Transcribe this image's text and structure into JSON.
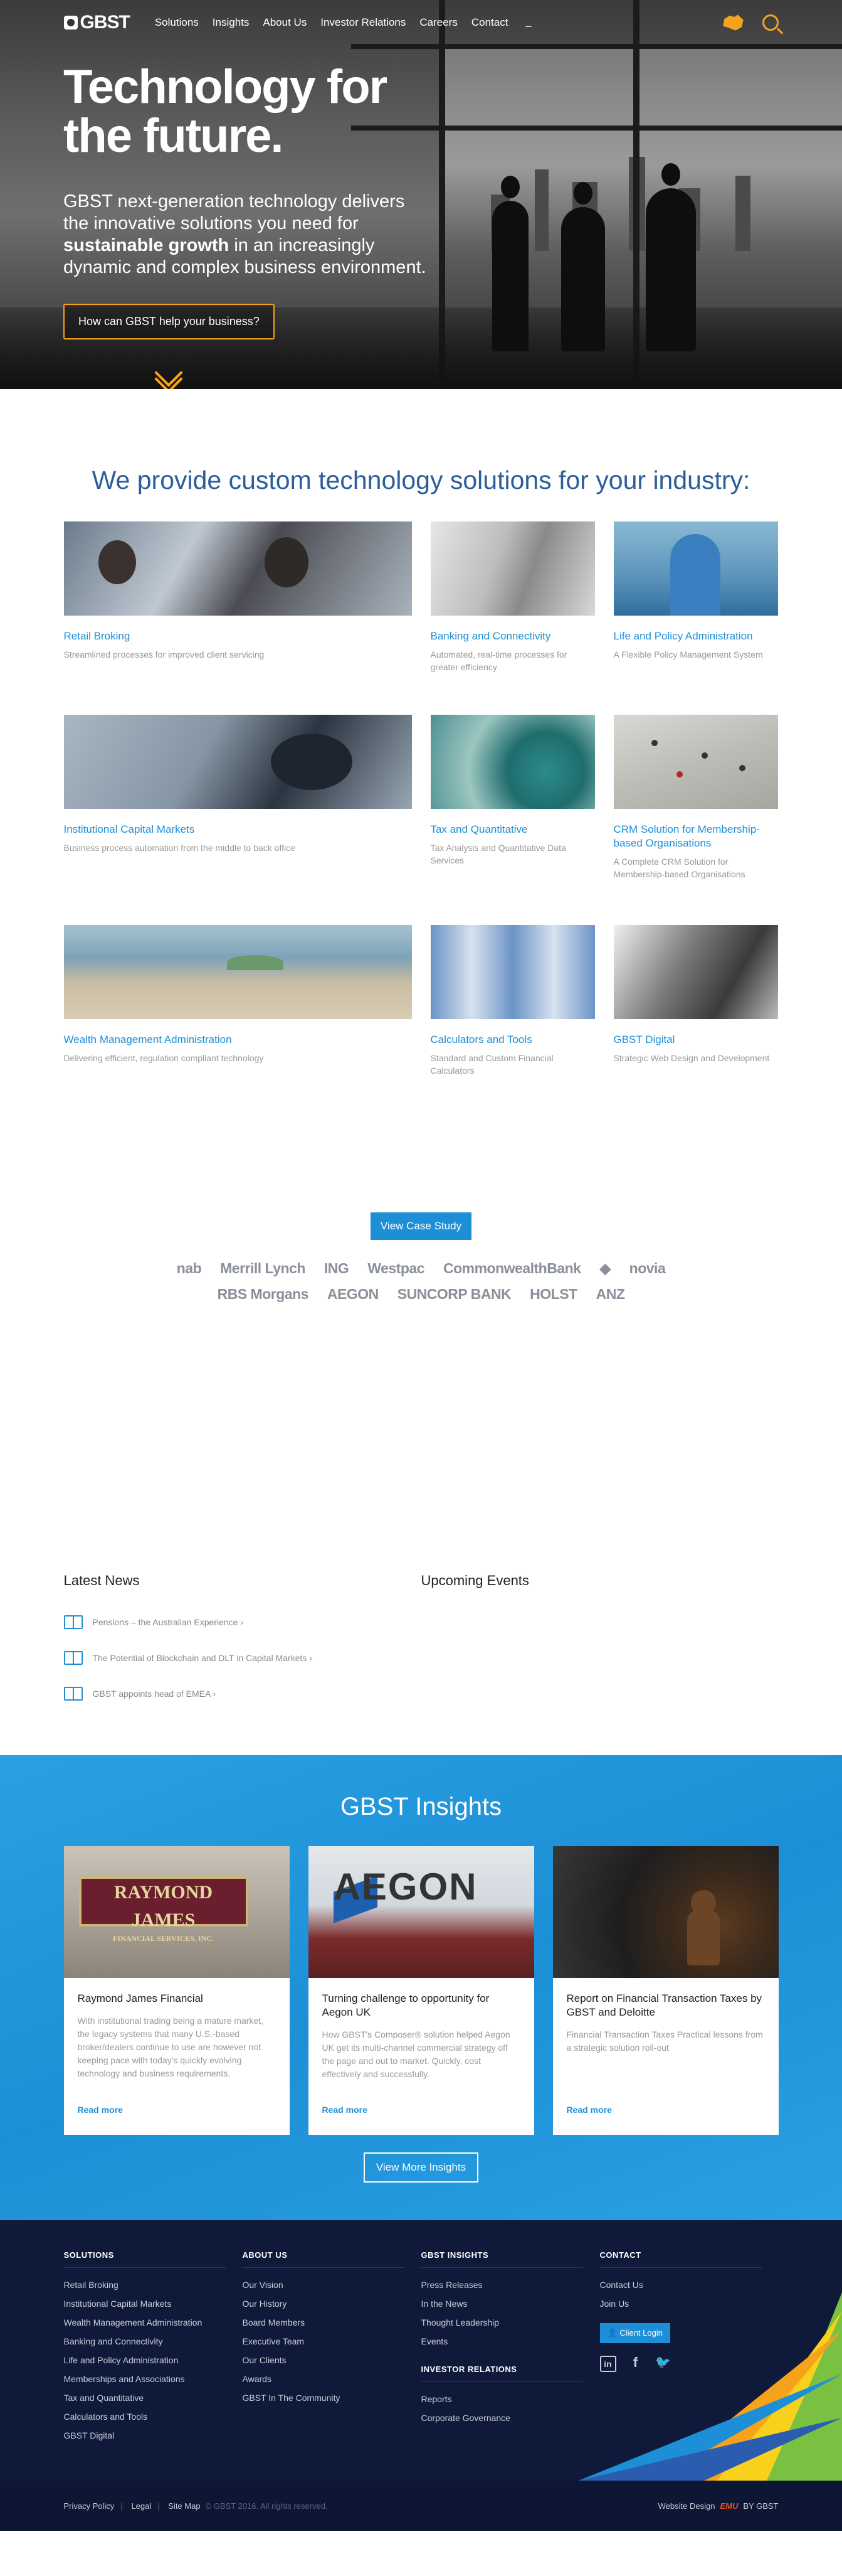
{
  "header": {
    "logo": "GBST",
    "nav": [
      "Solutions",
      "Insights",
      "About Us",
      "Investor Relations",
      "Careers",
      "Contact"
    ],
    "nav_extra": "_",
    "icons": [
      "australia-map-icon",
      "search-icon"
    ]
  },
  "hero": {
    "title": "Technology for the future.",
    "body_1": "GBST next-generation technology delivers the innovative solutions you need for ",
    "body_strong": "sustainable growth",
    "body_2": " in an increasingly dynamic and complex business environment.",
    "cta": "How can GBST help your business?"
  },
  "industries": {
    "title": "We provide custom technology solutions for your industry:",
    "cards": [
      {
        "title": "Retail Broking",
        "desc": "Streamlined processes for improved client servicing"
      },
      {
        "title": "Banking and Connectivity",
        "desc": "Automated, real-time processes for greater efficiency"
      },
      {
        "title": "Life and Policy Administration",
        "desc": "A Flexible Policy Management System"
      },
      {
        "title": "Institutional Capital Markets",
        "desc": "Business process automation from the middle to back office"
      },
      {
        "title": "Tax and Quantitative",
        "desc": "Tax Analysis and Quantitative Data Services"
      },
      {
        "title": "CRM Solution for Membership-based Organisations",
        "desc": "A Complete CRM Solution for Membership-based Organisations"
      },
      {
        "title": "Wealth Management Administration",
        "desc": "Delivering efficient, regulation compliant technology"
      },
      {
        "title": "Calculators and Tools",
        "desc": "Standard and Custom Financial Calculators"
      },
      {
        "title": "GBST Digital",
        "desc": "Strategic Web Design and Development"
      }
    ],
    "case_study_button": "View Case Study",
    "client_logos": [
      "nab",
      "Merrill Lynch",
      "ING",
      "Westpac",
      "CommonwealthBank",
      "◆",
      "novia",
      "RBS Morgans",
      "AEGON",
      "SUNCORP BANK",
      "HOLST",
      "ANZ"
    ]
  },
  "news": {
    "latest_title": "Latest News",
    "upcoming_title": "Upcoming Events",
    "items": [
      "Pensions – the Australian Experience ›",
      "The Potential of Blockchain and DLT in Capital Markets ›",
      "GBST appoints head of EMEA ›"
    ]
  },
  "insights": {
    "title": "GBST Insights",
    "cards": [
      {
        "title": "Raymond James Financial",
        "desc": "With institutional trading being a mature market, the legacy systems that many U.S.-based broker/dealers continue to use are however not keeping pace with today's quickly evolving technology and business requirements.",
        "more": "Read more",
        "sign": "RAYMOND JAMES",
        "sign_sub": "FINANCIAL SERVICES, INC."
      },
      {
        "title": "Turning challenge to opportunity for Aegon UK",
        "desc": "How GBST's Composer® solution helped Aegon UK get its multi-channel commercial strategy off the page and out to market. Quickly, cost effectively and successfully.",
        "more": "Read more",
        "sign": "AEGON"
      },
      {
        "title": "Report on Financial Transaction Taxes by GBST and Deloitte",
        "desc": "Financial Transaction Taxes Practical lessons from a strategic solution roll-out",
        "more": "Read more"
      }
    ],
    "more_button": "View More Insights"
  },
  "footer": {
    "solutions": {
      "title": "SOLUTIONS",
      "items": [
        "Retail Broking",
        "Institutional Capital Markets",
        "Wealth Management Administration",
        "Banking and Connectivity",
        "Life and Policy Administration",
        "Memberships and Associations",
        "Tax and Quantitative",
        "Calculators and Tools",
        "GBST Digital"
      ]
    },
    "about": {
      "title": "ABOUT US",
      "items": [
        "Our Vision",
        "Our History",
        "Board Members",
        "Executive Team",
        "Our Clients",
        "Awards",
        "GBST In The Community"
      ]
    },
    "insights": {
      "title": "GBST INSIGHTS",
      "items": [
        "Press Releases",
        "In the News",
        "Thought Leadership",
        "Events"
      ]
    },
    "investor": {
      "title": "INVESTOR RELATIONS",
      "items": [
        "Reports",
        "Corporate Governance"
      ]
    },
    "contact": {
      "title": "CONTACT",
      "items": [
        "Contact Us",
        "Join Us"
      ],
      "login": "Client Login"
    },
    "social": [
      "linkedin-icon",
      "facebook-icon",
      "twitter-icon"
    ],
    "bottom": {
      "links": [
        "Privacy Policy",
        "Legal",
        "Site Map"
      ],
      "copyright": "© GBST 2016. All rights reserved.",
      "credit": "Website Design",
      "credit_brand": "EMU",
      "credit_suffix": "BY GBST"
    }
  },
  "colors": {
    "accent_orange": "#f7a21b",
    "accent_blue": "#1d8fd6",
    "footer_navy": "#0f1a3b"
  }
}
